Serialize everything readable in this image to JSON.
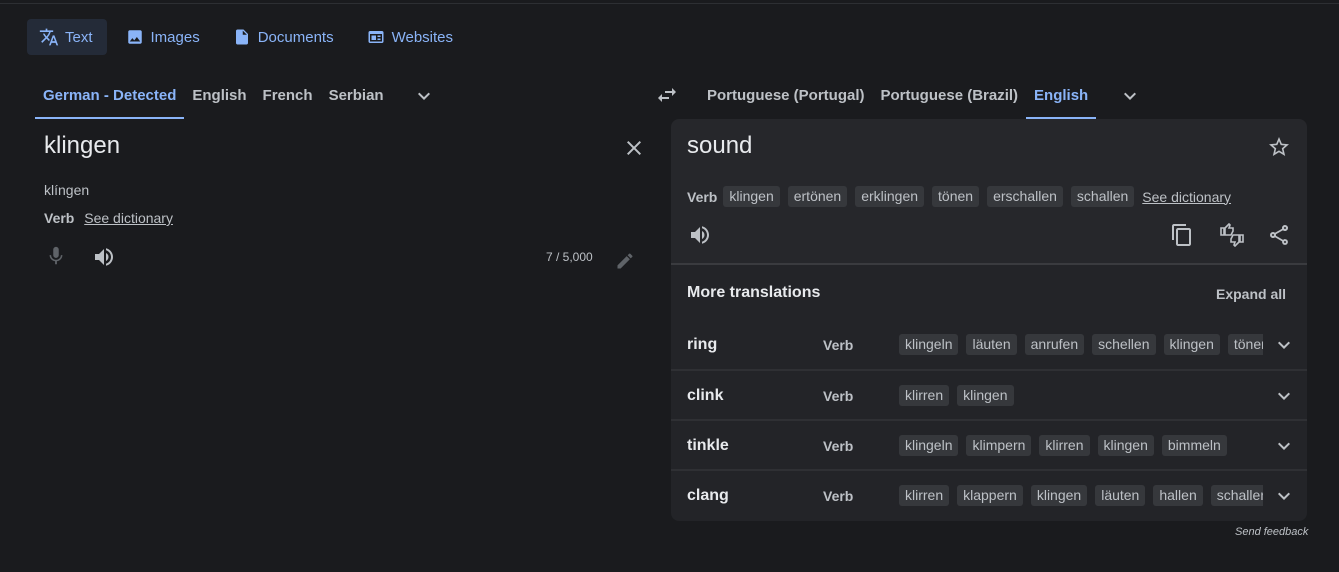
{
  "modes": [
    {
      "label": "Text",
      "icon": "translate-icon",
      "active": true
    },
    {
      "label": "Images",
      "icon": "image-icon"
    },
    {
      "label": "Documents",
      "icon": "document-icon"
    },
    {
      "label": "Websites",
      "icon": "website-icon"
    }
  ],
  "source_langs": [
    "German - Detected",
    "English",
    "French",
    "Serbian"
  ],
  "target_langs": [
    "Portuguese (Portugal)",
    "Portuguese (Brazil)",
    "English"
  ],
  "source": {
    "text": "klingen",
    "transliteration": "klíngen",
    "pos": "Verb",
    "dict_link": "See dictionary",
    "char_count": "7 / 5,000"
  },
  "target": {
    "text": "sound",
    "pos": "Verb",
    "synonyms": [
      "klingen",
      "ertönen",
      "erklingen",
      "tönen",
      "erschallen",
      "schallen"
    ],
    "dict_link": "See dictionary"
  },
  "more_translations": {
    "title": "More translations",
    "expand_label": "Expand all",
    "rows": [
      {
        "word": "ring",
        "pos": "Verb",
        "chips": [
          "klingeln",
          "läuten",
          "anrufen",
          "schellen",
          "klingen",
          "tönen"
        ]
      },
      {
        "word": "clink",
        "pos": "Verb",
        "chips": [
          "klirren",
          "klingen"
        ]
      },
      {
        "word": "tinkle",
        "pos": "Verb",
        "chips": [
          "klingeln",
          "klimpern",
          "klirren",
          "klingen",
          "bimmeln"
        ]
      },
      {
        "word": "clang",
        "pos": "Verb",
        "chips": [
          "klirren",
          "klappern",
          "klingen",
          "läuten",
          "hallen",
          "schallen"
        ]
      }
    ]
  },
  "feedback": "Send feedback",
  "colors": {
    "accent": "#8ab4f8",
    "background": "#1a1b1e",
    "card": "#26272b"
  }
}
